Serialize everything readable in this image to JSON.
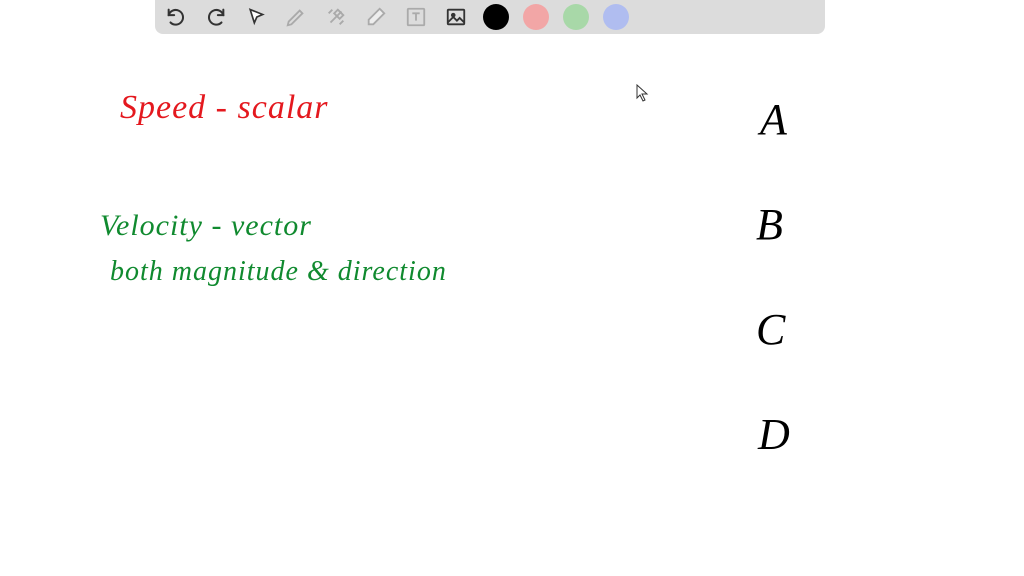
{
  "toolbar": {
    "colors": {
      "black": "#000000",
      "red": "#f2a6a6",
      "green": "#a8d8a8",
      "blue": "#b0bdf0"
    }
  },
  "notes": {
    "line1": "Speed  - scalar",
    "line2": "Velocity - vector",
    "line3": "both   magnitude  &  direction"
  },
  "options": {
    "a": "A",
    "b": "B",
    "c": "C",
    "d": "D"
  }
}
